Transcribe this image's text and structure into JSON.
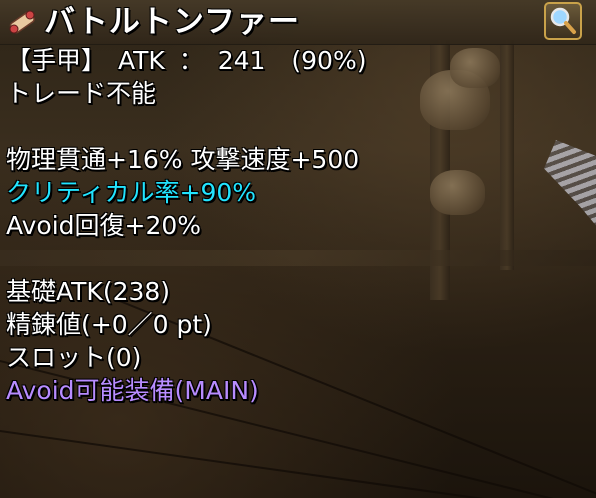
{
  "window": {
    "title": "バトルトンファー",
    "icon": "scroll-icon",
    "search_icon": "magnifier-icon"
  },
  "item": {
    "slot": "【手甲】",
    "atk_label": "ATK",
    "atk_sep": "：",
    "atk_value": "241",
    "atk_percent": "(90%)",
    "trade": "トレード不能",
    "bonus_line1": "物理貫通+16% 攻撃速度+500",
    "bonus_line2": "クリティカル率+90%",
    "bonus_line3": "Avoid回復+20%",
    "base_atk": "基礎ATK(238)",
    "refine": "精錬値(+0／0 pt)",
    "slots": "スロット(0)",
    "equip": "Avoid可能装備(MAIN)"
  },
  "colors": {
    "normal_text": "#ffffff",
    "highlight_cyan": "#22e4ff",
    "highlight_purple": "#b88cff",
    "title_bar": "#3a2e1e",
    "frame_gold": "#c9a24a"
  }
}
